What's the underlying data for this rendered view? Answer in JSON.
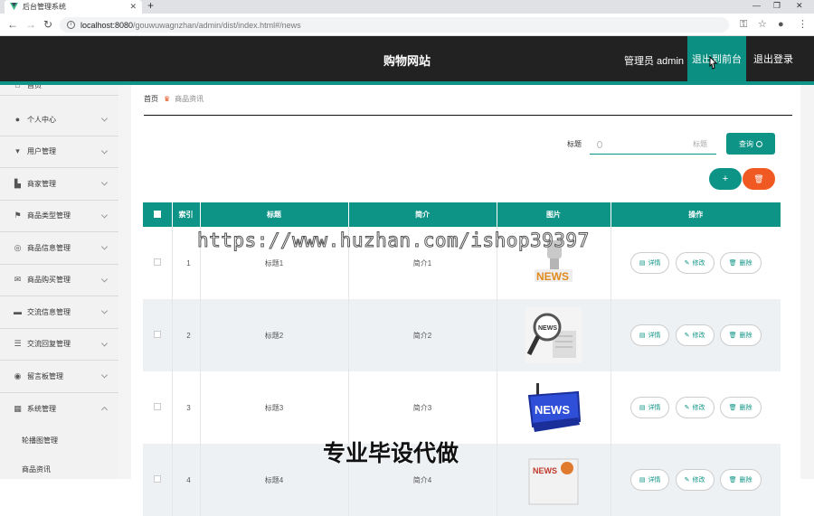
{
  "browser": {
    "tab_title": "后台管理系统",
    "tab_close": "✕",
    "new_tab": "+",
    "url_host": "localhost:8080",
    "url_path": "/gouwuwagnzhan/admin/dist/index.html#/news"
  },
  "header": {
    "site_title": "购物网站",
    "admin_label": "管理员 admin",
    "front_button": "退出到前台",
    "logout_button": "退出登录"
  },
  "sidebar": {
    "items": [
      {
        "label": "首页",
        "icon": "home-icon"
      },
      {
        "label": "个人中心",
        "icon": "user-icon"
      },
      {
        "label": "用户管理",
        "icon": "user-mgmt-icon"
      },
      {
        "label": "商家管理",
        "icon": "shop-icon"
      },
      {
        "label": "商品类型管理",
        "icon": "flag-icon"
      },
      {
        "label": "商品信息管理",
        "icon": "compass-icon"
      },
      {
        "label": "商品购买管理",
        "icon": "mail-icon"
      },
      {
        "label": "交流信息管理",
        "icon": "chat-icon"
      },
      {
        "label": "交流回复管理",
        "icon": "sliders-icon"
      },
      {
        "label": "留言板管理",
        "icon": "target-icon"
      },
      {
        "label": "系统管理",
        "icon": "grid-icon"
      }
    ],
    "sub_items": [
      {
        "label": "轮播图管理"
      },
      {
        "label": "商品资讯"
      }
    ]
  },
  "breadcrumb": {
    "home": "首页",
    "current": "商品资讯"
  },
  "search": {
    "label": "标题",
    "placeholder": "标题",
    "button": "查询"
  },
  "actions": {
    "add": "+",
    "delete": "🗑"
  },
  "table": {
    "headers": [
      "",
      "索引",
      "标题",
      "简介",
      "图片",
      "操作"
    ],
    "buttons": {
      "detail": "详情",
      "edit": "修改",
      "delete": "删除"
    },
    "rows": [
      {
        "index": "1",
        "title": "标题1",
        "intro": "简介1",
        "image": "news-robot"
      },
      {
        "index": "2",
        "title": "标题2",
        "intro": "简介2",
        "image": "news-magnifier"
      },
      {
        "index": "3",
        "title": "标题3",
        "intro": "简介3",
        "image": "news-key"
      },
      {
        "index": "4",
        "title": "标题4",
        "intro": "简介4",
        "image": "news-paper"
      }
    ]
  },
  "watermarks": {
    "url": "https://www.huzhan.com/ishop39397",
    "text": "专业毕设代做"
  },
  "colors": {
    "accent": "#0e9486",
    "header_bg": "#222222",
    "danger": "#f05a22"
  }
}
